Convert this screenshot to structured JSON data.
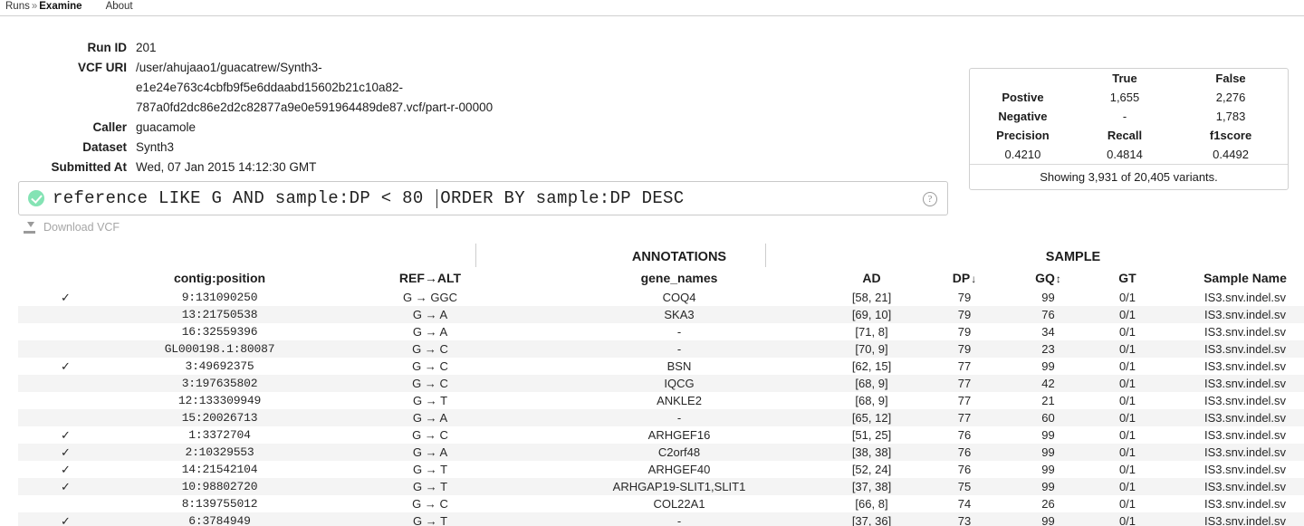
{
  "nav": {
    "breadcrumb_root": "Runs",
    "breadcrumb_sep": "»",
    "breadcrumb_current": "Examine",
    "about": "About"
  },
  "meta": {
    "rows": [
      {
        "label": "Run ID",
        "value": "201"
      },
      {
        "label": "Caller",
        "value": "guacamole"
      },
      {
        "label": "Dataset",
        "value": "Synth3"
      },
      {
        "label": "Submitted At",
        "value": "Wed, 07 Jan 2015 14:12:30 GMT"
      }
    ],
    "vcf_uri_label": "VCF URI",
    "vcf_uri_lines": [
      "/user/ahujaao1/guacatrew/Synth3-",
      "e1e24e763c4cbfb9f5e6ddaabd15602b21c10a82-",
      "787a0fd2dc86e2d2c82877a9e0e591964489de87.vcf/part-r-00000"
    ]
  },
  "stats": {
    "col_true": "True",
    "col_false": "False",
    "row_positive": "Postive",
    "row_negative": "Negative",
    "true_positive": "1,655",
    "false_positive": "2,276",
    "true_negative": "-",
    "false_negative": "1,783",
    "precision_label": "Precision",
    "recall_label": "Recall",
    "f1_label": "f1score",
    "precision_value": "0.4210",
    "recall_value": "0.4814",
    "f1_value": "0.4492",
    "footer": "Showing 3,931 of 20,405 variants."
  },
  "query": {
    "status_icon": "check-circle-icon",
    "text_before_caret": "reference LIKE G AND sample:DP < 80 ",
    "text_after_caret": "ORDER BY sample:DP DESC",
    "help_glyph": "?"
  },
  "download": {
    "label": "Download VCF",
    "icon": "download-icon"
  },
  "table": {
    "group_annotations": "ANNOTATIONS",
    "group_sample": "SAMPLE",
    "headers": {
      "check": "",
      "position": "contig:position",
      "ref_alt": "REF→ALT",
      "gene_names": "gene_names",
      "ad": "AD",
      "dp": "DP",
      "dp_sort": "↓",
      "gq": "GQ",
      "gq_sort": "↕",
      "gt": "GT",
      "sample_name": "Sample Name"
    },
    "rows": [
      {
        "check": "✓",
        "position": "9:131090250",
        "ref_alt": "G → GGC",
        "gene_names": "COQ4",
        "ad": "[58, 21]",
        "dp": "79",
        "gq": "99",
        "gt": "0/1",
        "sample_name": "IS3.snv.indel.sv"
      },
      {
        "check": "",
        "position": "13:21750538",
        "ref_alt": "G → A",
        "gene_names": "SKA3",
        "ad": "[69, 10]",
        "dp": "79",
        "gq": "76",
        "gt": "0/1",
        "sample_name": "IS3.snv.indel.sv"
      },
      {
        "check": "",
        "position": "16:32559396",
        "ref_alt": "G → A",
        "gene_names": "-",
        "ad": "[71, 8]",
        "dp": "79",
        "gq": "34",
        "gt": "0/1",
        "sample_name": "IS3.snv.indel.sv"
      },
      {
        "check": "",
        "position": "GL000198.1:80087",
        "ref_alt": "G → C",
        "gene_names": "-",
        "ad": "[70, 9]",
        "dp": "79",
        "gq": "23",
        "gt": "0/1",
        "sample_name": "IS3.snv.indel.sv"
      },
      {
        "check": "✓",
        "position": "3:49692375",
        "ref_alt": "G → C",
        "gene_names": "BSN",
        "ad": "[62, 15]",
        "dp": "77",
        "gq": "99",
        "gt": "0/1",
        "sample_name": "IS3.snv.indel.sv"
      },
      {
        "check": "",
        "position": "3:197635802",
        "ref_alt": "G → C",
        "gene_names": "IQCG",
        "ad": "[68, 9]",
        "dp": "77",
        "gq": "42",
        "gt": "0/1",
        "sample_name": "IS3.snv.indel.sv"
      },
      {
        "check": "",
        "position": "12:133309949",
        "ref_alt": "G → T",
        "gene_names": "ANKLE2",
        "ad": "[68, 9]",
        "dp": "77",
        "gq": "21",
        "gt": "0/1",
        "sample_name": "IS3.snv.indel.sv"
      },
      {
        "check": "",
        "position": "15:20026713",
        "ref_alt": "G → A",
        "gene_names": "-",
        "ad": "[65, 12]",
        "dp": "77",
        "gq": "60",
        "gt": "0/1",
        "sample_name": "IS3.snv.indel.sv"
      },
      {
        "check": "✓",
        "position": "1:3372704",
        "ref_alt": "G → C",
        "gene_names": "ARHGEF16",
        "ad": "[51, 25]",
        "dp": "76",
        "gq": "99",
        "gt": "0/1",
        "sample_name": "IS3.snv.indel.sv"
      },
      {
        "check": "✓",
        "position": "2:10329553",
        "ref_alt": "G → A",
        "gene_names": "C2orf48",
        "ad": "[38, 38]",
        "dp": "76",
        "gq": "99",
        "gt": "0/1",
        "sample_name": "IS3.snv.indel.sv"
      },
      {
        "check": "✓",
        "position": "14:21542104",
        "ref_alt": "G → T",
        "gene_names": "ARHGEF40",
        "ad": "[52, 24]",
        "dp": "76",
        "gq": "99",
        "gt": "0/1",
        "sample_name": "IS3.snv.indel.sv"
      },
      {
        "check": "✓",
        "position": "10:98802720",
        "ref_alt": "G → T",
        "gene_names": "ARHGAP19-SLIT1,SLIT1",
        "ad": "[37, 38]",
        "dp": "75",
        "gq": "99",
        "gt": "0/1",
        "sample_name": "IS3.snv.indel.sv"
      },
      {
        "check": "",
        "position": "8:139755012",
        "ref_alt": "G → C",
        "gene_names": "COL22A1",
        "ad": "[66, 8]",
        "dp": "74",
        "gq": "26",
        "gt": "0/1",
        "sample_name": "IS3.snv.indel.sv"
      },
      {
        "check": "✓",
        "position": "6:3784949",
        "ref_alt": "G → T",
        "gene_names": "-",
        "ad": "[37, 36]",
        "dp": "73",
        "gq": "99",
        "gt": "0/1",
        "sample_name": "IS3.snv.indel.sv"
      }
    ]
  }
}
